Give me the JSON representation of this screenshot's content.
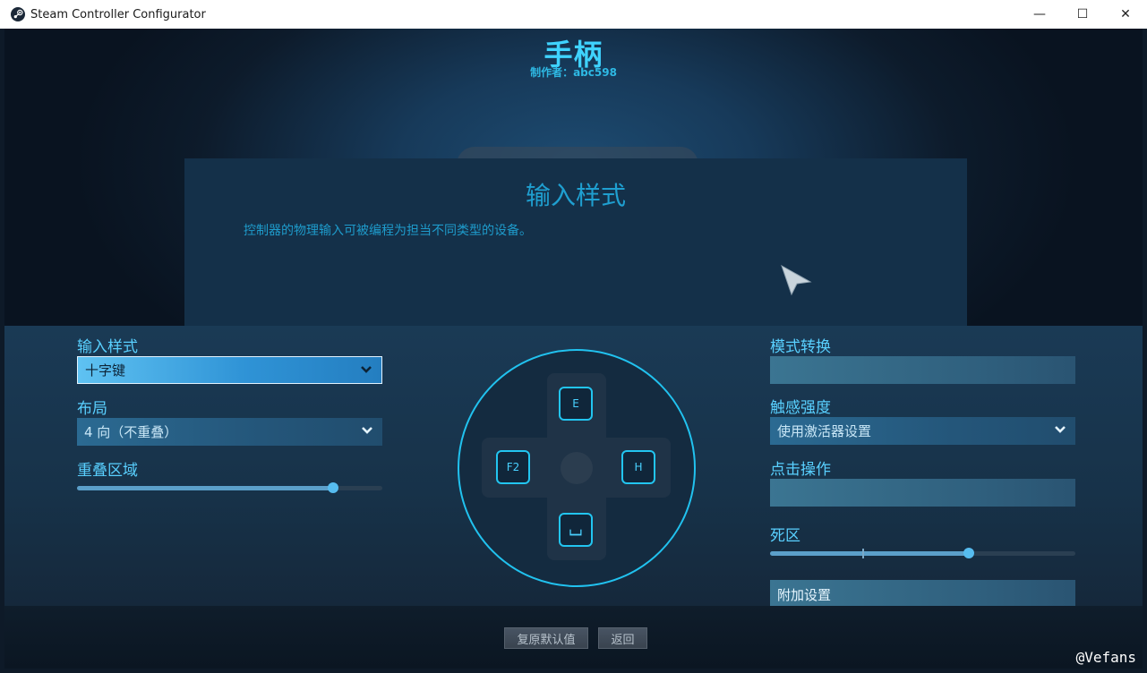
{
  "window": {
    "title": "Steam Controller Configurator",
    "controls": {
      "minimize": "—",
      "maximize": "☐",
      "close": "✕"
    }
  },
  "header": {
    "title": "手柄",
    "author": "制作者：abc598"
  },
  "info": {
    "title": "输入样式",
    "description": "控制器的物理输入可被编程为担当不同类型的设备。"
  },
  "left": {
    "input_style": {
      "label": "输入样式",
      "value": "十字键"
    },
    "layout": {
      "label": "布局",
      "value": "4 向（不重叠）"
    },
    "overlap": {
      "label": "重叠区域",
      "value": 0.84
    }
  },
  "dpad": {
    "up": "E",
    "left": "F2",
    "right": "H",
    "down": "⌴"
  },
  "right": {
    "mode_switch": {
      "label": "模式转换",
      "value": ""
    },
    "haptic": {
      "label": "触感强度",
      "value": "使用激活器设置"
    },
    "click_action": {
      "label": "点击操作",
      "value": ""
    },
    "deadzone": {
      "label": "死区",
      "value": 0.65
    },
    "extra": {
      "label": "附加设置"
    }
  },
  "footer": {
    "reset_label": "复原默认值",
    "back_label": "返回"
  },
  "watermark": "@Vefans",
  "colors": {
    "accent": "#3fd3ff",
    "panel": "#173249",
    "dpad_border": "#21c2ef"
  }
}
